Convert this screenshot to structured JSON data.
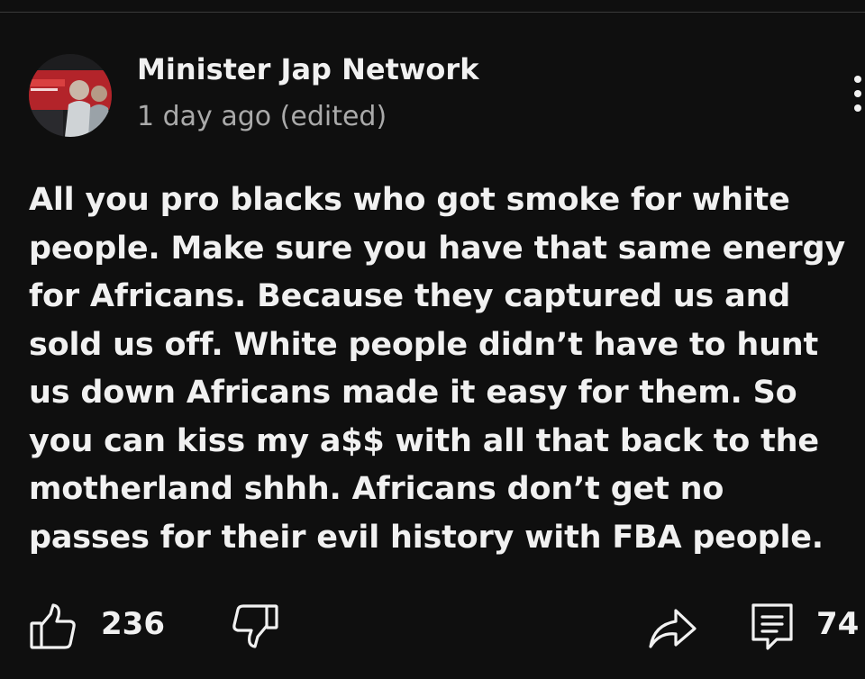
{
  "comment": {
    "author": "Minister Jap Network",
    "time": "1 day ago (edited)",
    "text": "All you pro blacks who got smoke for white\npeople. Make sure you have that same energy\nfor Africans. Because they captured us and\nsold us off. White people didn’t have to hunt\nus down Africans made it easy for them. So\nyou can kiss my a$$ with all that back to the\nmotherland shhh. Africans don’t get no\npasses for their evil history with FBA people."
  },
  "actions": {
    "like_count": "236",
    "reply_count": "74"
  },
  "icons": {
    "more": "more-vertical-icon",
    "like": "thumbs-up-icon",
    "dislike": "thumbs-down-icon",
    "share": "share-arrow-icon",
    "reply": "comment-reply-icon"
  },
  "colors": {
    "background": "#0f0f0f",
    "primary_text": "#f1f1f1",
    "secondary_text": "#aaaaaa",
    "avatar_accent": "#c0262b"
  }
}
